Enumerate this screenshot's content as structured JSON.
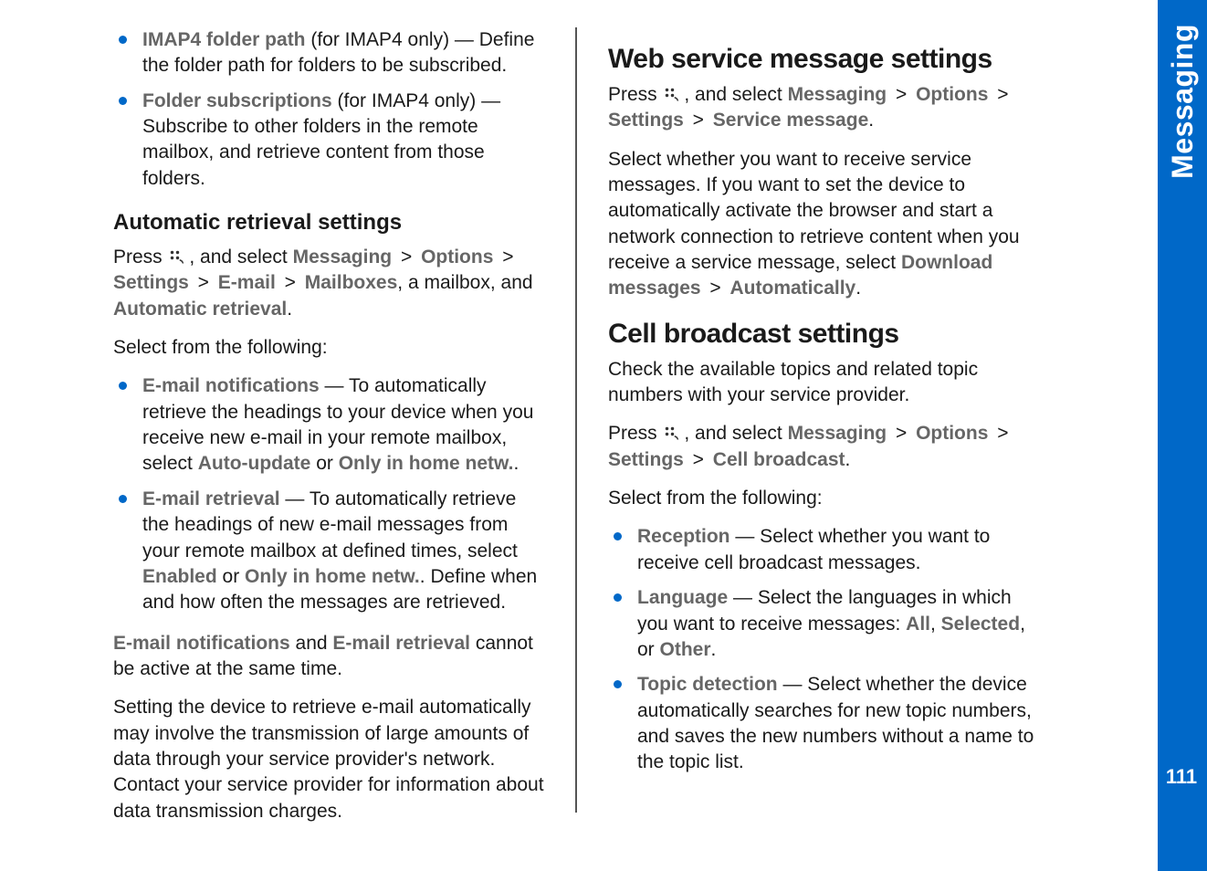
{
  "sidebar": {
    "section": "Messaging",
    "pageNumber": "111"
  },
  "left": {
    "list1": [
      {
        "term": "IMAP4 folder path",
        "tail": " (for IMAP4 only)  — Define the folder path for folders to be subscribed."
      },
      {
        "term": "Folder subscriptions",
        "tail": " (for IMAP4 only)  — Subscribe to other folders in the remote mailbox, and retrieve content from those folders."
      }
    ],
    "h3": "Automatic retrieval settings",
    "press1_pre": "Press ",
    "press1_afterIcon": " , and select ",
    "nav1": {
      "a": "Messaging",
      "b": "Options",
      "c": "Settings",
      "d": "E-mail",
      "e": "Mailboxes"
    },
    "press1_mid": ", a mailbox, and ",
    "press1_end": "Automatic retrieval",
    "press1_period": ".",
    "selectFrom": "Select from the following:",
    "list2": [
      {
        "term": "E-mail notifications",
        "mid": "  — To automatically retrieve the headings to your device when you receive new e-mail in your remote mailbox, select ",
        "opt1": "Auto-update",
        "or": " or ",
        "opt2": "Only in home netw.",
        "period": "."
      },
      {
        "term": "E-mail retrieval",
        "mid": "  — To automatically retrieve the headings of new e-mail messages from your remote mailbox at defined times, select ",
        "opt1": "Enabled",
        "or": " or ",
        "opt2": "Only in home netw.",
        "tail2": ". Define when and how often the messages are retrieved."
      }
    ],
    "note_a": "E-mail notifications",
    "note_mid": " and ",
    "note_b": "E-mail retrieval",
    "note_tail": " cannot be active at the same time.",
    "para_last": "Setting the device to retrieve e-mail automatically may involve the transmission of large amounts of data through your service provider's network. Contact your service provider for information about data transmission charges."
  },
  "right": {
    "h2a": "Web service message settings",
    "press2_pre": "Press ",
    "press2_afterIcon": " , and select ",
    "nav2": {
      "a": "Messaging",
      "b": "Options",
      "c": "Settings",
      "d": "Service message"
    },
    "period": ".",
    "para2a": "Select whether you want to receive service messages. If you want to set the device to automatically activate the browser and start a network connection to retrieve content when you receive a service message, select ",
    "dm": "Download messages",
    "gt": " > ",
    "auto": "Automatically",
    "h2b": "Cell broadcast settings",
    "para2b": "Check the available topics and related topic numbers with your service provider.",
    "press3_pre": "Press ",
    "press3_afterIcon": " , and select ",
    "nav3": {
      "a": "Messaging",
      "b": "Options",
      "c": "Settings",
      "d": "Cell broadcast"
    },
    "selectFrom": "Select from the following:",
    "list3": [
      {
        "term": "Reception",
        "tail": "  — Select whether you want to receive cell broadcast messages."
      },
      {
        "term": "Language",
        "mid": "  — Select the languages in which you want to receive messages: ",
        "o1": "All",
        "c1": ", ",
        "o2": "Selected",
        "c2": ", or ",
        "o3": "Other",
        "period": "."
      },
      {
        "term": "Topic detection",
        "tail": "  — Select whether the device automatically searches for new topic numbers, and saves the new numbers without a name to the topic list."
      }
    ]
  }
}
